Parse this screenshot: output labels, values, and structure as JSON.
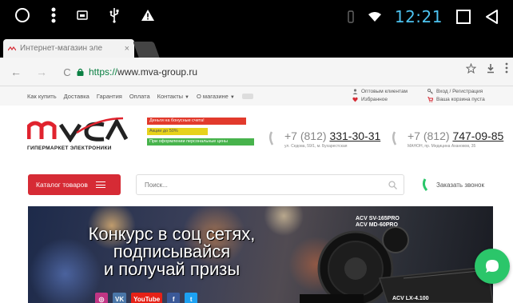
{
  "status_bar": {
    "time": "12:21",
    "left_icons": [
      "circle-home-icon",
      "vertical-dots-icon",
      "sim-card-icon",
      "usb-icon",
      "warning-icon"
    ],
    "right_icons": [
      "vibrate-icon",
      "wifi-icon",
      "square-recents-icon",
      "triangle-back-icon"
    ],
    "time_color": "#4dc3f0"
  },
  "browser": {
    "tab": {
      "title": "Интернет-магазин эле",
      "close": "×"
    },
    "address": {
      "scheme": "https://",
      "host": "www.mva-group.ru"
    },
    "nav": {
      "back": "←",
      "forward": "→",
      "reload": "C"
    }
  },
  "site": {
    "topnav": {
      "items": [
        "Как купить",
        "Доставка",
        "Гарантия",
        "Оплата",
        "Контакты",
        "О магазине"
      ],
      "dropdown_indices": [
        4,
        5
      ],
      "user_links": {
        "wholesale": "Оптовым клиентам",
        "login": "Вход / Регистрация",
        "favorites": "Избранное",
        "cart": "Ваша корзина пуста"
      }
    },
    "header": {
      "logo_tagline": "ГИПЕРМАРКЕТ ЭЛЕКТРОНИКИ",
      "promos": [
        {
          "text": "Деньги на бонусные счета!",
          "color": "#e23a2c"
        },
        {
          "text": "Акции до 50%",
          "color": "#e7d21b"
        },
        {
          "text": "При оформлении персональные цены",
          "color": "#47b34c"
        }
      ],
      "phones": [
        {
          "prefix": "+7 (812) ",
          "number": "331-30-31",
          "address": "ул. Седова, 59/1, м. Бухарестская"
        },
        {
          "prefix": "+7 (812) ",
          "number": "747-09-85",
          "address": "МАНОН, пр. Медицина Ахановов, 35"
        }
      ]
    },
    "search": {
      "catalog_label": "Каталог товаров",
      "placeholder": "Поиск...",
      "callback_label": "Заказать звонок"
    },
    "banner": {
      "lines": [
        "Конкурс в соц сетях,",
        "подписывайся",
        "и получай призы"
      ],
      "social": [
        {
          "name": "instagram",
          "label": "◎",
          "color": "#c13584"
        },
        {
          "name": "vk",
          "label": "VK",
          "color": "#4a76a8"
        },
        {
          "name": "youtube",
          "label": "YouTube",
          "color": "#e62117"
        },
        {
          "name": "facebook",
          "label": "f",
          "color": "#3b5998"
        },
        {
          "name": "twitter",
          "label": "t",
          "color": "#1da1f2"
        }
      ],
      "product_labels": [
        "ACV SV-165PRO",
        "ACV MD-60PRO"
      ],
      "product_bottom": "ACV LX-4.100"
    },
    "brand_colors": {
      "red": "#d62b35",
      "green": "#2bc66a"
    }
  }
}
